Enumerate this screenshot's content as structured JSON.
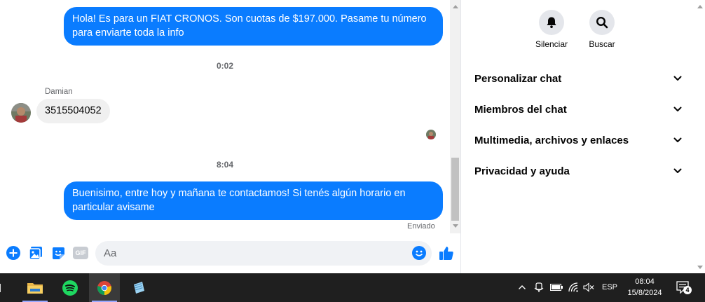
{
  "colors": {
    "accent": "#0a7cff",
    "incoming_bubble": "#f0f0f0",
    "taskbar": "#1f1f1f"
  },
  "chat": {
    "messages": [
      {
        "direction": "outgoing",
        "text_line1": "Hola! Es para un FIAT CRONOS. Son cuotas de $197.000. Pasame tu número",
        "text_line2": "para enviarte toda la info"
      },
      {
        "type": "timestamp",
        "text": "0:02"
      },
      {
        "direction": "incoming",
        "sender": "Damian",
        "text": "3515504052"
      },
      {
        "type": "timestamp",
        "text": "8:04"
      },
      {
        "direction": "outgoing",
        "text_line1": "Buenisimo, entre hoy y mañana te contactamos! Si tenés algún horario en",
        "text_line2": "particular avisame",
        "status": "Enviado"
      }
    ]
  },
  "composer": {
    "placeholder": "Aa",
    "icons": [
      "plus-icon",
      "photo-icon",
      "sticker-icon",
      "gif-icon",
      "emoji-icon",
      "thumbs-up-icon"
    ],
    "gif_label": "GIF"
  },
  "panel": {
    "actions": [
      {
        "icon": "bell-icon",
        "label": "Silenciar"
      },
      {
        "icon": "search-icon",
        "label": "Buscar"
      }
    ],
    "sections": [
      "Personalizar chat",
      "Miembros del chat",
      "Multimedia, archivos y enlaces",
      "Privacidad y ayuda"
    ]
  },
  "taskbar": {
    "apps": [
      "file-explorer-icon",
      "spotify-icon",
      "chrome-icon",
      "notepad-icon"
    ],
    "tray": {
      "language": "ESP",
      "time": "08:04",
      "date": "15/8/2024",
      "notification_count": "4"
    }
  }
}
